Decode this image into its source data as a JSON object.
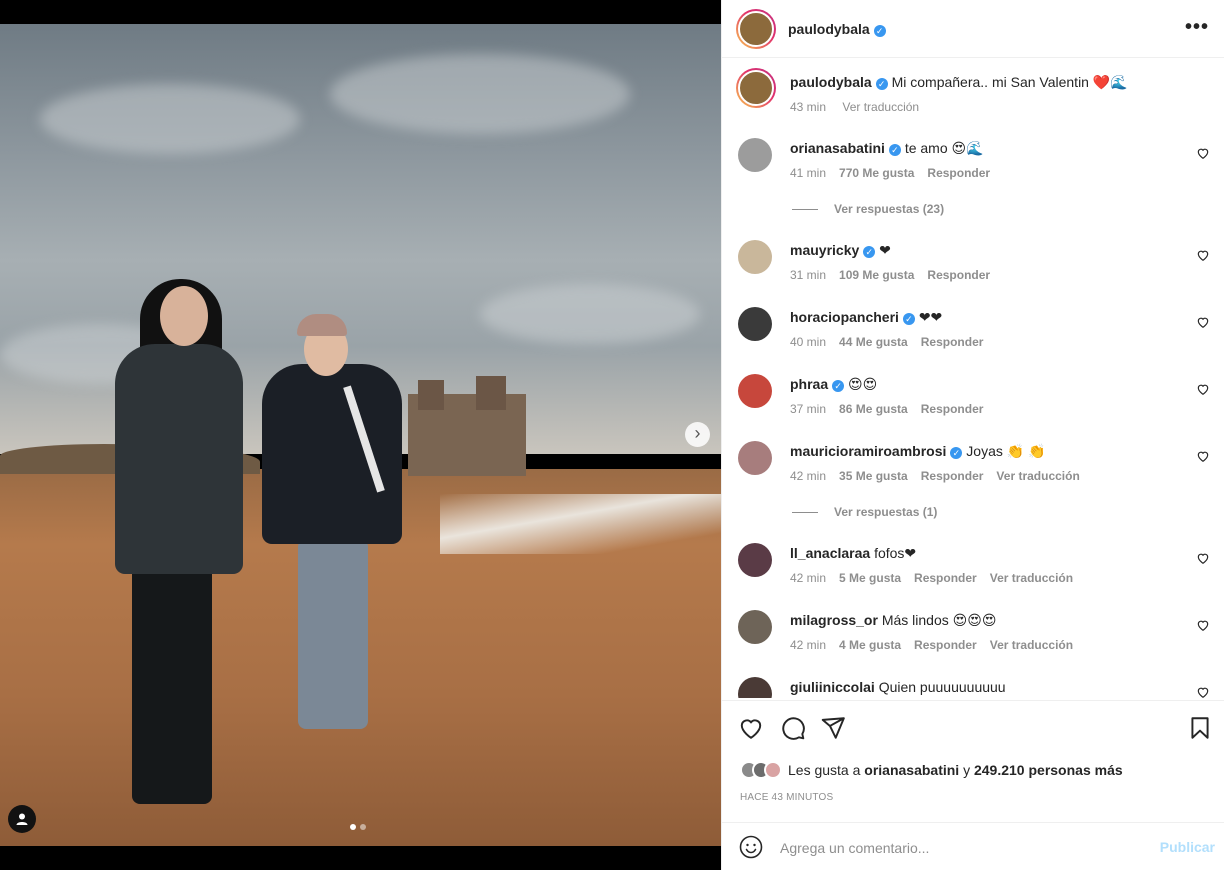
{
  "post": {
    "username": "paulodybala",
    "caption": "Mi compañera.. mi San Valentin ❤️🌊",
    "caption_time": "43 min",
    "see_translation": "Ver traducción",
    "more_label": "•••"
  },
  "comments": [
    {
      "user": "orianasabatini",
      "verified": true,
      "text": "te amo 😍🌊",
      "time": "41 min",
      "likes": "770 Me gusta",
      "reply": "Responder",
      "translate": "",
      "replies": "Ver respuestas (23)"
    },
    {
      "user": "mauyricky",
      "verified": true,
      "text": "❤",
      "time": "31 min",
      "likes": "109 Me gusta",
      "reply": "Responder",
      "translate": "",
      "replies": ""
    },
    {
      "user": "horaciopancheri",
      "verified": true,
      "text": "❤❤",
      "time": "40 min",
      "likes": "44 Me gusta",
      "reply": "Responder",
      "translate": "",
      "replies": ""
    },
    {
      "user": "phraa",
      "verified": true,
      "text": "😍😍",
      "time": "37 min",
      "likes": "86 Me gusta",
      "reply": "Responder",
      "translate": "",
      "replies": ""
    },
    {
      "user": "mauricioramiroambrosi",
      "verified": true,
      "text": "Joyas 👏 👏",
      "time": "42 min",
      "likes": "35 Me gusta",
      "reply": "Responder",
      "translate": "Ver traducción",
      "replies": "Ver respuestas (1)"
    },
    {
      "user": "ll_anaclaraa",
      "verified": false,
      "text": "fofos❤",
      "time": "42 min",
      "likes": "5 Me gusta",
      "reply": "Responder",
      "translate": "Ver traducción",
      "replies": ""
    },
    {
      "user": "milagross_or",
      "verified": false,
      "text": "Más lindos 😍😍😍",
      "time": "42 min",
      "likes": "4 Me gusta",
      "reply": "Responder",
      "translate": "Ver traducción",
      "replies": ""
    },
    {
      "user": "giuliiniccolai",
      "verified": false,
      "text": "Quien puuuuuuuuuu",
      "time": "",
      "likes": "",
      "reply": "",
      "translate": "",
      "replies": ""
    }
  ],
  "likes": {
    "prefix": "Les gusta a",
    "user": "orianasabatini",
    "suffix": "y",
    "count": "249.210 personas más"
  },
  "time_ago": "HACE 43 MINUTOS",
  "add_comment": {
    "placeholder": "Agrega un comentario...",
    "publish": "Publicar"
  },
  "icons": {
    "like": "heart-icon",
    "comment": "comment-icon",
    "share": "send-icon",
    "save": "bookmark-icon",
    "emoji": "emoji-icon",
    "next": "chevron-right-icon",
    "tag": "user-tag-icon"
  },
  "colors": {
    "verified": "#3897f0",
    "publish_disabled": "#b2dffc",
    "muted": "#8e8e8e"
  },
  "carousel": {
    "slides": 2,
    "current": 1
  }
}
